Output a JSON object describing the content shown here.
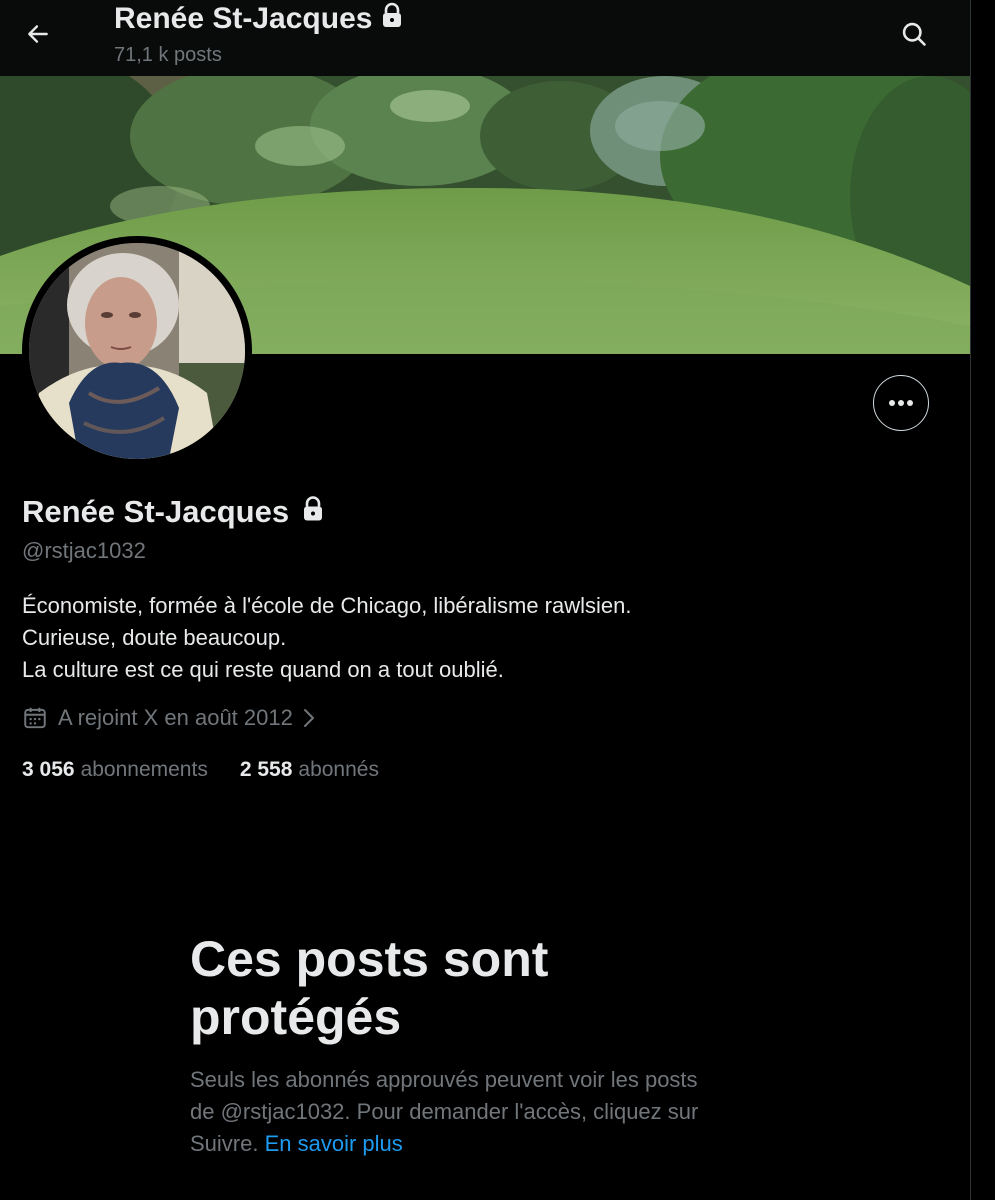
{
  "header": {
    "title": "Renée St-Jacques",
    "post_count": "71,1 k posts"
  },
  "profile": {
    "name": "Renée St-Jacques",
    "handle": "@rstjac1032",
    "bio_lines": [
      "Économiste, formée à l'école de Chicago, libéralisme rawlsien.",
      "Curieuse, doute beaucoup.",
      "La culture est ce qui reste quand on a tout oublié."
    ],
    "joined": "A rejoint X en août 2012",
    "following_count": "3 056",
    "following_label": "abonnements",
    "followers_count": "2 558",
    "followers_label": "abonnés"
  },
  "protected": {
    "title_line1": "Ces posts sont",
    "title_line2": "protégés",
    "desc_line1": "Seuls les abonnés approuvés peuvent voir les posts",
    "desc_line2": "de @rstjac1032. Pour demander l'accès, cliquez sur",
    "desc_line3_prefix": "Suivre.",
    "learn_more": "En savoir plus"
  },
  "icons": {
    "back": "arrow-left-icon",
    "search": "search-icon",
    "lock": "lock-icon",
    "more": "more-dots-icon",
    "calendar": "calendar-icon",
    "chevron": "chevron-right-icon"
  },
  "colors": {
    "background": "#000000",
    "text_primary": "#e7e9ea",
    "text_secondary": "#71767b",
    "link": "#1d9bf0"
  }
}
